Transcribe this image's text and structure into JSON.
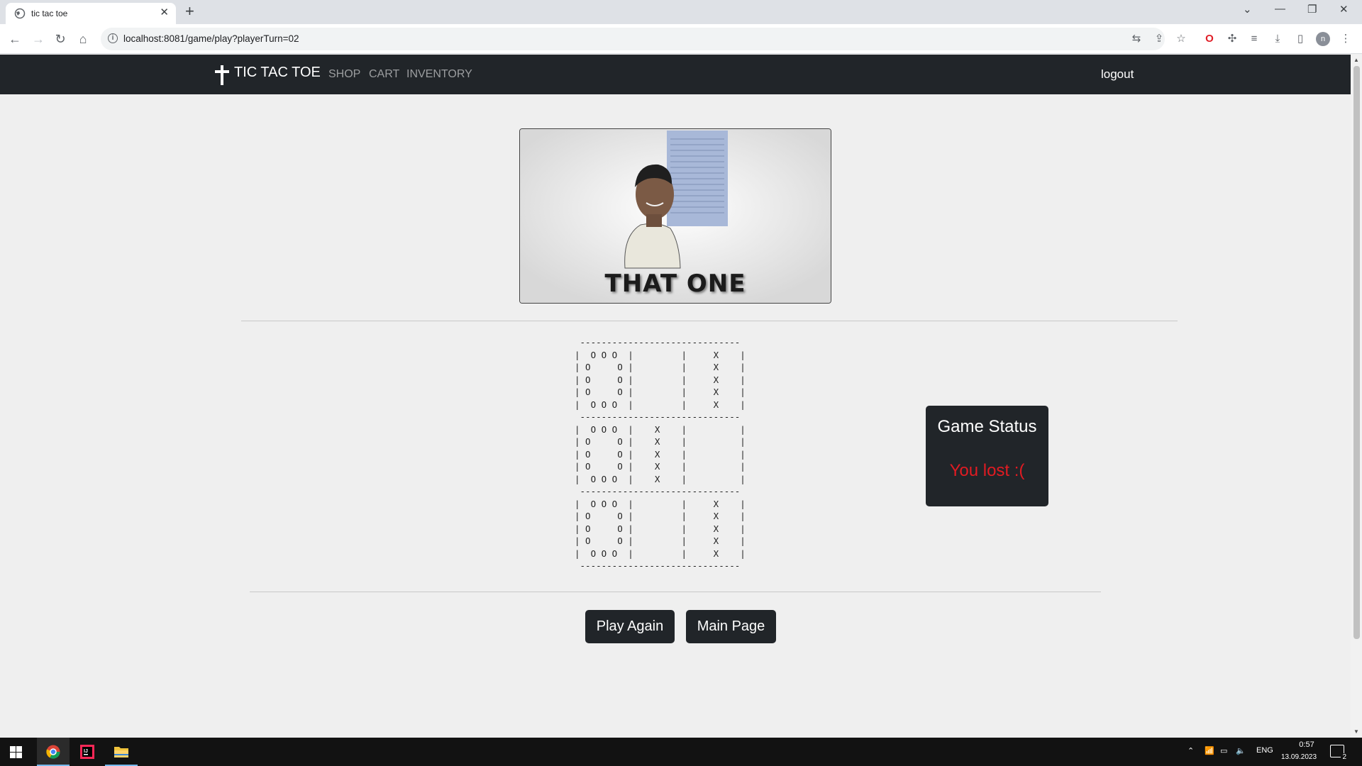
{
  "browser": {
    "tab_title": "tic tac toe",
    "url": "localhost:8081/game/play?playerTurn=02"
  },
  "navbar": {
    "brand": "TIC TAC TOE",
    "links": [
      "SHOP",
      "CART",
      "INVENTORY"
    ],
    "logout": "logout"
  },
  "banner": {
    "caption": "THAT ONE"
  },
  "board": {
    "art": " ------------------------------\n|  O O O  |         |     X    |\n| O     O |         |     X    |\n| O     O |         |     X    |\n| O     O |         |     X    |\n|  O O O  |         |     X    |\n ------------------------------\n|  O O O  |    X    |          |\n| O     O |    X    |          |\n| O     O |    X    |          |\n| O     O |    X    |          |\n|  O O O  |    X    |          |\n ------------------------------\n|  O O O  |         |     X    |\n| O     O |         |     X    |\n| O     O |         |     X    |\n| O     O |         |     X    |\n|  O O O  |         |     X    |\n ------------------------------"
  },
  "game_status": {
    "title": "Game Status",
    "message": "You lost :("
  },
  "buttons": {
    "play_again": "Play Again",
    "main_page": "Main Page"
  },
  "taskbar": {
    "language": "ENG",
    "time": "0:57",
    "date": "13.09.2023",
    "notifications": "2"
  },
  "colors": {
    "navbar": "#212529",
    "lost": "#e11b22",
    "page_bg": "#efefef"
  }
}
